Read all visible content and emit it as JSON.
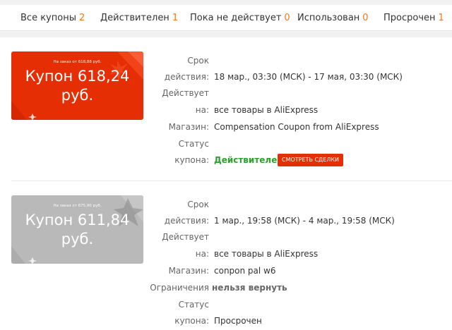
{
  "tabs": [
    {
      "label": "Все купоны",
      "count": "2"
    },
    {
      "label": "Действителен",
      "count": "1"
    },
    {
      "label": "Пока не действует",
      "count": "0"
    },
    {
      "label": "Использован",
      "count": "0"
    },
    {
      "label": "Просрочен",
      "count": "1"
    }
  ],
  "coupons": [
    {
      "min_order": "На заказ от 618,88 руб.",
      "amount_line1": "Купон 618,24",
      "amount_line2": "руб.",
      "labels": {
        "period_1": "Срок",
        "period_2": "действия:",
        "applies_1": "Действует",
        "applies_2": "на:",
        "store": "Магазин:",
        "status_1": "Статус",
        "status_2": "купона:"
      },
      "period": "18 мар., 03:30 (МСК) - 17 мая, 03:30 (МСК)",
      "applies": "все товары в AliExpress",
      "store": "Compensation Coupon from AliExpress",
      "status": "Действителен",
      "button": "Смотреть сделки",
      "color": "#e62e04"
    },
    {
      "min_order": "На заказ от 675,90 руб.",
      "amount_line1": "Купон 611,84",
      "amount_line2": "руб.",
      "labels": {
        "period_1": "Срок",
        "period_2": "действия:",
        "applies_1": "Действует",
        "applies_2": "на:",
        "store": "Магазин:",
        "restrictions": "Ограничения",
        "status_1": "Статус",
        "status_2": "купона:"
      },
      "period": "1 мар., 19:58 (МСК) - 4 мар., 19:58 (МСК)",
      "applies": "все товары в AliExpress",
      "store": "conpon pal w6",
      "restrictions": "нельзя вернуть",
      "status": "Просрочен",
      "color": "#b9b9b9"
    }
  ],
  "colors": {
    "accent": "#e62e04",
    "count": "#f4781e",
    "valid": "#2aa12b",
    "expired_card": "#b9b9b9"
  }
}
